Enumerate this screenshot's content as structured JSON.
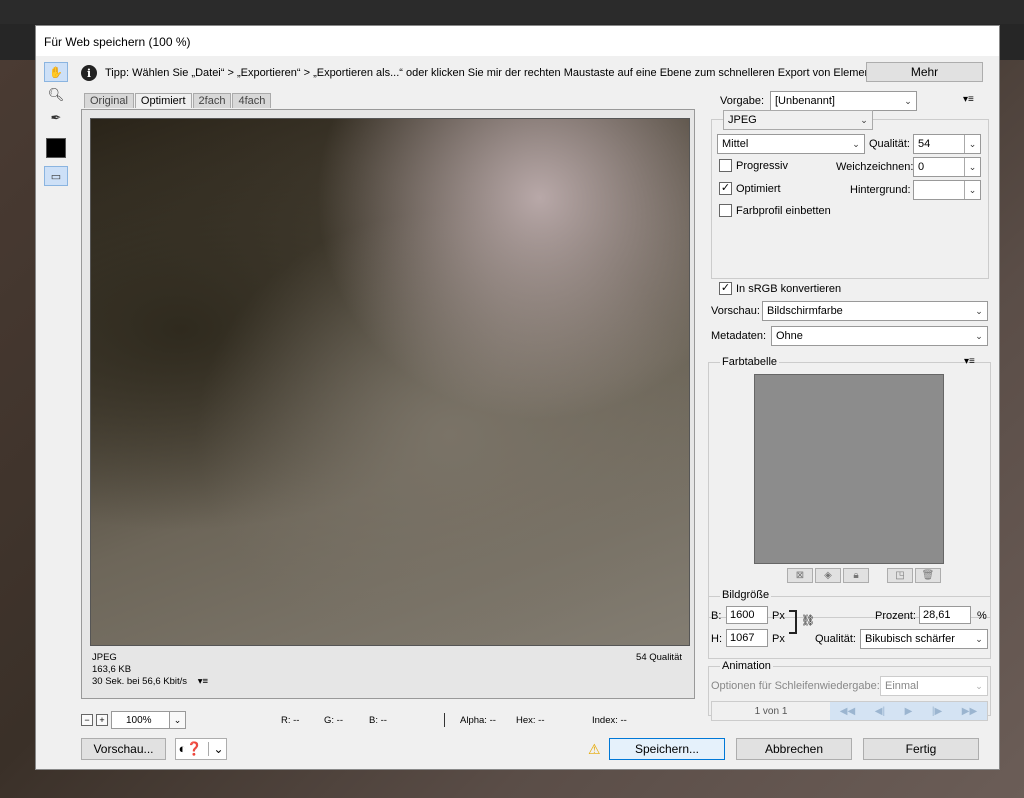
{
  "dialog": {
    "title": "Für Web speichern (100 %)"
  },
  "tip": {
    "text": "Tipp: Wählen Sie „Datei“ > „Exportieren“ > „Exportieren als...“ oder klicken Sie mir der rechten Maustaste auf eine Ebene zum schnelleren Export von Elementen",
    "more_label": "Mehr"
  },
  "tabs": [
    "Original",
    "Optimiert",
    "2fach",
    "4fach"
  ],
  "image_info": {
    "format": "JPEG",
    "size": "163,6 KB",
    "time": "30 Sek. bei 56,6 Kbit/s",
    "quality": "54 Qualität"
  },
  "status": {
    "zoom": "100%",
    "r": "R: --",
    "g": "G: --",
    "b": "B: --",
    "alpha": "Alpha: --",
    "hex": "Hex: --",
    "index": "Index: --"
  },
  "bottom": {
    "preview_label": "Vorschau...",
    "save_label": "Speichern...",
    "cancel_label": "Abbrechen",
    "done_label": "Fertig"
  },
  "settings": {
    "preset_label": "Vorgabe:",
    "preset_value": "[Unbenannt]",
    "format_value": "JPEG",
    "quality_level": "Mittel",
    "quality_label": "Qualität:",
    "quality_value": "54",
    "progressive_label": "Progressiv",
    "blur_label": "Weichzeichnen:",
    "blur_value": "0",
    "optimized_label": "Optimiert",
    "background_label": "Hintergrund:",
    "embed_profile_label": "Farbprofil einbetten",
    "srgb_label": "In sRGB konvertieren",
    "preview_label": "Vorschau:",
    "preview_value": "Bildschirmfarbe",
    "metadata_label": "Metadaten:",
    "metadata_value": "Ohne"
  },
  "color_table": {
    "title": "Farbtabelle"
  },
  "image_size": {
    "title": "Bildgröße",
    "w_label": "B:",
    "w_value": "1600",
    "h_label": "H:",
    "h_value": "1067",
    "unit": "Px",
    "percent_label": "Prozent:",
    "percent_value": "28,61",
    "percent_sign": "%",
    "quality_label": "Qualität:",
    "quality_value": "Bikubisch schärfer"
  },
  "animation": {
    "title": "Animation",
    "loop_label": "Optionen für Schleifenwiedergabe:",
    "loop_value": "Einmal",
    "frame": "1 von 1"
  }
}
